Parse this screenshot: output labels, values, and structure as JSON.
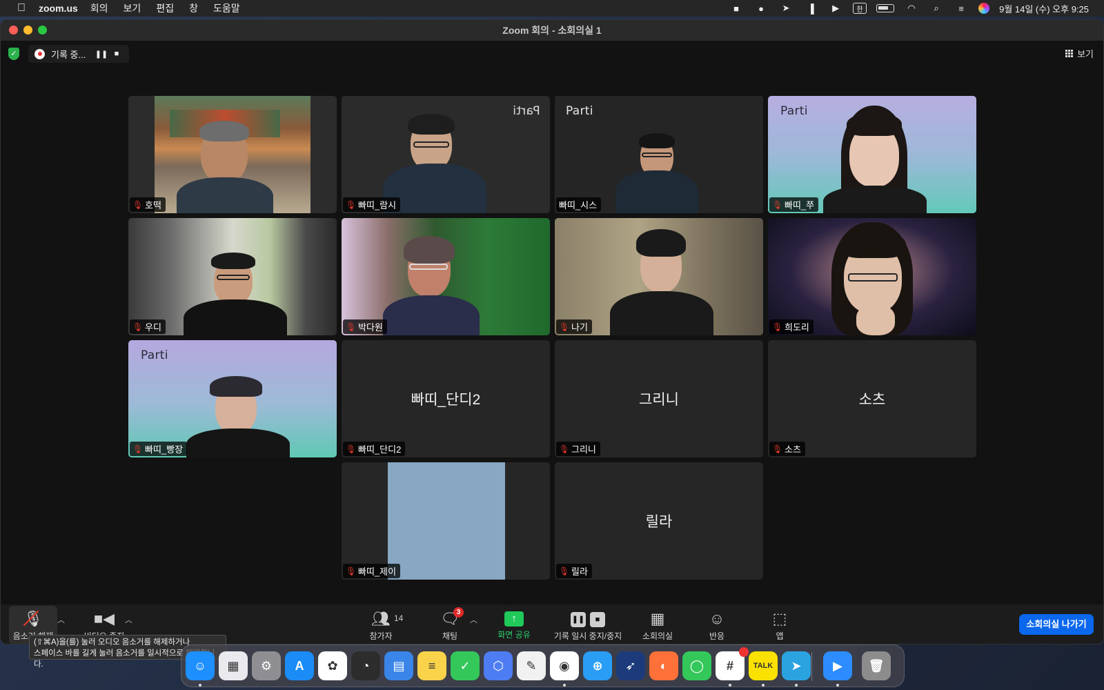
{
  "menubar": {
    "app_name": "zoom.us",
    "menus": [
      "회의",
      "보기",
      "편집",
      "창",
      "도움말"
    ],
    "ime_indicator": "한",
    "clock": "9월 14일 (수) 오후  9:25"
  },
  "window": {
    "title": "Zoom 회의 - 소회의실 1",
    "recording_label": "기록 중...",
    "view_label": "보기"
  },
  "participants": [
    {
      "name": "호떡",
      "muted": true,
      "video": true,
      "active": false
    },
    {
      "name": "빠띠_람시",
      "muted": true,
      "video": true,
      "active": false,
      "watermark": "Parti"
    },
    {
      "name": "빠띠_시스",
      "muted": false,
      "video": true,
      "active": true,
      "watermark": "Parti"
    },
    {
      "name": "빠띠_쭈",
      "muted": true,
      "video": true,
      "active": false,
      "watermark": "Parti"
    },
    {
      "name": "우디",
      "muted": true,
      "video": true,
      "active": false
    },
    {
      "name": "박다원",
      "muted": true,
      "video": true,
      "active": false
    },
    {
      "name": "나기",
      "muted": true,
      "video": true,
      "active": false
    },
    {
      "name": "희도리",
      "muted": true,
      "video": true,
      "active": false
    },
    {
      "name": "빠띠_빵장",
      "muted": true,
      "video": true,
      "active": false,
      "watermark": "Parti"
    },
    {
      "name": "빠띠_단디2",
      "muted": true,
      "video": false,
      "active": false
    },
    {
      "name": "그리니",
      "muted": true,
      "video": false,
      "active": false
    },
    {
      "name": "소츠",
      "muted": true,
      "video": false,
      "active": false
    },
    {
      "name": "빠띠_제이",
      "muted": true,
      "video": true,
      "active": false
    },
    {
      "name": "릴라",
      "muted": true,
      "video": false,
      "active": false
    }
  ],
  "toolbar": {
    "audio_label": "음소거 해제",
    "video_label": "비디오 중지",
    "participants_label": "참가자",
    "participants_count": "14",
    "chat_label": "채팅",
    "chat_badge": "3",
    "share_label": "화면 공유",
    "record_label": "기록 일시 중지/중지",
    "breakout_label": "소회의실",
    "reactions_label": "반응",
    "apps_label": "앱",
    "leave_label": "소회의실 나가기"
  },
  "tooltip": {
    "line1": "(⇧⌘A)을(를) 눌러 오디오 음소거를 해제하거나",
    "line2": "스페이스 바를 길게 눌러 음소거를 일시적으로 해제합니다."
  },
  "dock": [
    {
      "name": "Finder",
      "color": "#1e8fff",
      "glyph": "☺"
    },
    {
      "name": "Launchpad",
      "color": "#e9e9ee",
      "glyph": "▦"
    },
    {
      "name": "System Settings",
      "color": "#8e8e93",
      "glyph": "⚙"
    },
    {
      "name": "App Store",
      "color": "#1b8cf5",
      "glyph": "A"
    },
    {
      "name": "Photos",
      "color": "#ffffff",
      "glyph": "✿"
    },
    {
      "name": "Activity",
      "color": "#2d2d2d",
      "glyph": "◔"
    },
    {
      "name": "Files",
      "color": "#3a86e8",
      "glyph": "▤"
    },
    {
      "name": "Notes",
      "color": "#fbd34a",
      "glyph": "≡"
    },
    {
      "name": "Check",
      "color": "#34c759",
      "glyph": "✓"
    },
    {
      "name": "Cube",
      "color": "#4e7cf3",
      "glyph": "⬡"
    },
    {
      "name": "TextEdit",
      "color": "#f1f1f1",
      "glyph": "✎"
    },
    {
      "name": "Chrome",
      "color": "#ffffff",
      "glyph": "◉"
    },
    {
      "name": "Safari",
      "color": "#2a9df4",
      "glyph": "⊕"
    },
    {
      "name": "Bird",
      "color": "#1d3b7a",
      "glyph": "➶"
    },
    {
      "name": "Firefox",
      "color": "#ff7139",
      "glyph": "◐"
    },
    {
      "name": "Messages",
      "color": "#34c759",
      "glyph": "◯"
    },
    {
      "name": "Slack",
      "color": "#ffffff",
      "glyph": "#"
    },
    {
      "name": "KakaoTalk",
      "color": "#fae100",
      "glyph": "TALK"
    },
    {
      "name": "Telegram",
      "color": "#2aa3e0",
      "glyph": "➤"
    },
    {
      "name": "Zoom",
      "color": "#2d8cff",
      "glyph": "▶"
    },
    {
      "name": "Trash",
      "color": "#8c8c8c",
      "glyph": "🗑"
    }
  ],
  "colors": {
    "active_speaker": "#23d86a",
    "mute_red": "#e8392b",
    "leave_blue": "#0b67ec",
    "share_green": "#1fc95a"
  }
}
